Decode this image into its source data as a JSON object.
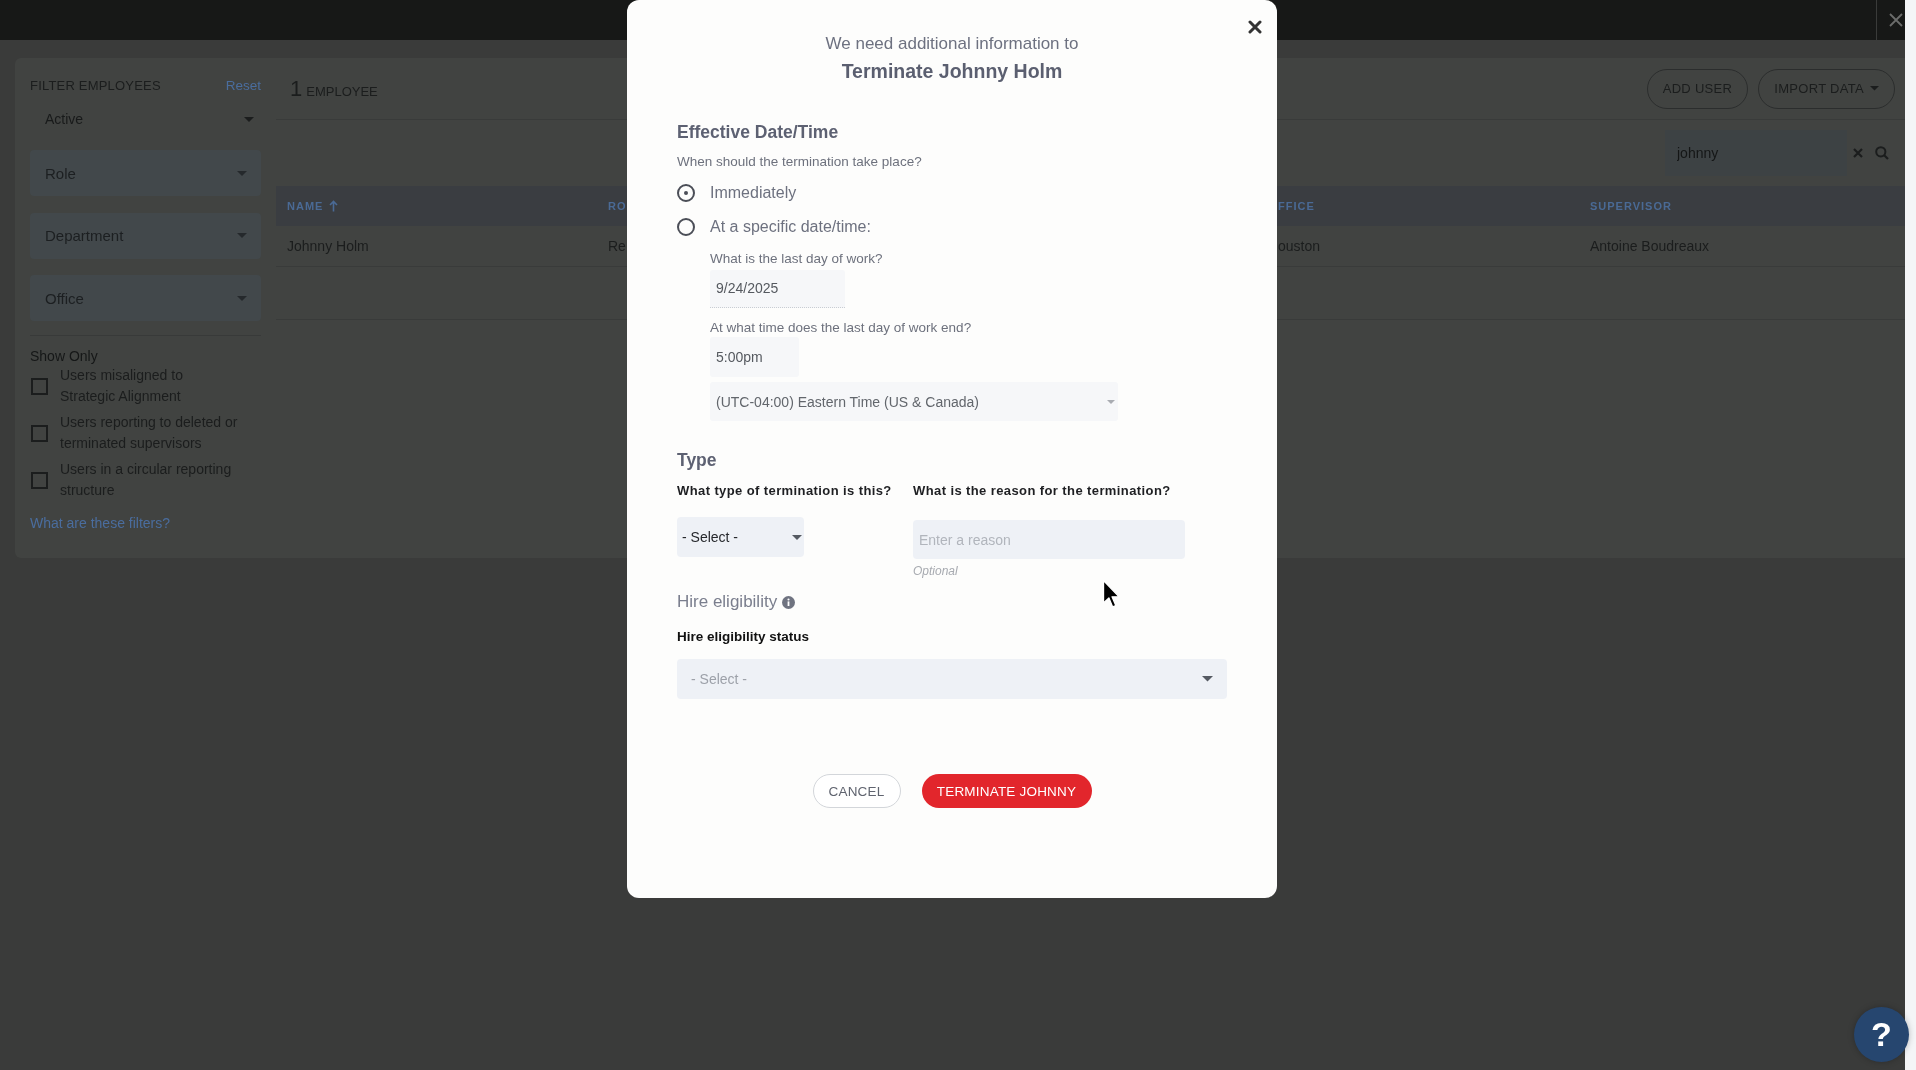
{
  "sidebar": {
    "title": "FILTER EMPLOYEES",
    "reset_link": "Reset",
    "filters": [
      {
        "value": "Active"
      },
      {
        "placeholder": "Role"
      },
      {
        "placeholder": "Department"
      },
      {
        "placeholder": "Office"
      }
    ],
    "show_only": {
      "title": "Show Only",
      "options": [
        {
          "label": "Users misaligned to Strategic Alignment",
          "checked": false
        },
        {
          "label": "Users reporting to deleted or terminated supervisors",
          "checked": false
        },
        {
          "label": "Users in a circular reporting structure",
          "checked": false
        }
      ]
    },
    "help_link": "What are these filters?"
  },
  "toolbar": {
    "count": "1",
    "count_label": "EMPLOYEE",
    "buttons": [
      {
        "label": "ADD USER",
        "kind": "plain"
      },
      {
        "label": "IMPORT DATA",
        "kind": "dropdown"
      }
    ]
  },
  "search": {
    "value": "johnny"
  },
  "table": {
    "columns": [
      {
        "label": "NAME",
        "sorted": true
      },
      {
        "label": "RO",
        "sorted": false
      },
      {
        "label": "FFICE",
        "sorted": false
      },
      {
        "label": "SUPERVISOR",
        "sorted": false
      }
    ],
    "rows": [
      {
        "cells": [
          "Johnny Holm",
          "Re",
          "ouston",
          "Antoine Boudreaux"
        ]
      }
    ]
  },
  "dialog": {
    "subtitle": "We need additional information to",
    "title": "Terminate Johnny Holm",
    "timing": {
      "heading": "Effective Date/Time",
      "question": "When should the termination take place?",
      "options": [
        {
          "label": "Immediately",
          "selected": true
        },
        {
          "label": "At a specific date/time:",
          "selected": false
        }
      ],
      "last_day": {
        "label": "What is the last day of work?",
        "value": "9/24/2025"
      },
      "end_time": {
        "label": "At what time does the last day of work end?",
        "value": "5:00pm"
      },
      "timezone": {
        "value": "(UTC-04:00) Eastern Time (US & Canada)"
      }
    },
    "type": {
      "heading": "Type",
      "termination_type": {
        "label": "What type of termination is this?",
        "value": "- Select -"
      },
      "reason": {
        "label": "What is the reason for the termination?",
        "placeholder": "Enter a reason",
        "hint": "Optional"
      }
    },
    "hire_eligibility": {
      "heading": "Hire eligibility",
      "status": {
        "label": "Hire eligibility status",
        "placeholder": "- Select -"
      }
    },
    "buttons": [
      {
        "label": "CANCEL",
        "kind": "secondary"
      },
      {
        "label": "TERMINATE JOHNNY",
        "kind": "danger"
      }
    ]
  },
  "help_button": {
    "label": "?"
  }
}
